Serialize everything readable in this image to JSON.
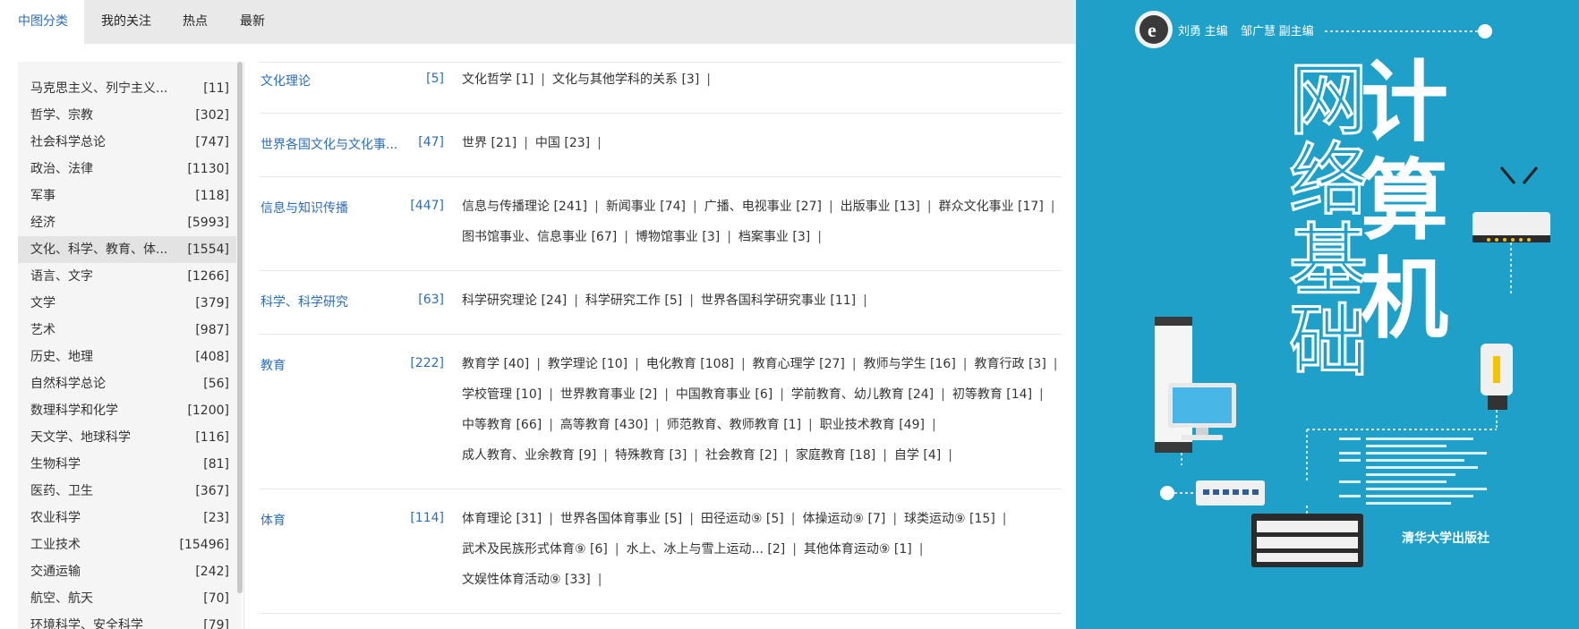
{
  "tabs": [
    {
      "label": "中图分类",
      "active": true
    },
    {
      "label": "我的关注",
      "active": false
    },
    {
      "label": "热点",
      "active": false
    },
    {
      "label": "最新",
      "active": false
    }
  ],
  "left_categories": [
    {
      "name": "马克思主义、列宁主义...",
      "count": "[11]"
    },
    {
      "name": "哲学、宗教",
      "count": "[302]"
    },
    {
      "name": "社会科学总论",
      "count": "[747]"
    },
    {
      "name": "政治、法律",
      "count": "[1130]"
    },
    {
      "name": "军事",
      "count": "[118]"
    },
    {
      "name": "经济",
      "count": "[5993]"
    },
    {
      "name": "文化、科学、教育、体...",
      "count": "[1554]",
      "selected": true
    },
    {
      "name": "语言、文字",
      "count": "[1266]"
    },
    {
      "name": "文学",
      "count": "[379]"
    },
    {
      "name": "艺术",
      "count": "[987]"
    },
    {
      "name": "历史、地理",
      "count": "[408]"
    },
    {
      "name": "自然科学总论",
      "count": "[56]"
    },
    {
      "name": "数理科学和化学",
      "count": "[1200]"
    },
    {
      "name": "天文学、地球科学",
      "count": "[116]"
    },
    {
      "name": "生物科学",
      "count": "[81]"
    },
    {
      "name": "医药、卫生",
      "count": "[367]"
    },
    {
      "name": "农业科学",
      "count": "[23]"
    },
    {
      "name": "工业技术",
      "count": "[15496]"
    },
    {
      "name": "交通运输",
      "count": "[242]"
    },
    {
      "name": "航空、航天",
      "count": "[70]"
    },
    {
      "name": "环境科学、安全科学",
      "count": "[79]"
    }
  ],
  "sections": [
    {
      "title": "文化理论",
      "count": "[5]",
      "lines": [
        [
          "文化哲学 [1]",
          "文化与其他学科的关系 [3]"
        ]
      ]
    },
    {
      "title": "世界各国文化与文化事...",
      "count": "[47]",
      "lines": [
        [
          "世界 [21]",
          "中国 [23]"
        ]
      ]
    },
    {
      "title": "信息与知识传播",
      "count": "[447]",
      "lines": [
        [
          "信息与传播理论 [241]",
          "新闻事业 [74]",
          "广播、电视事业 [27]",
          "出版事业 [13]",
          "群众文化事业 [17]"
        ],
        [
          "图书馆事业、信息事业 [67]",
          "博物馆事业 [3]",
          "档案事业 [3]"
        ]
      ]
    },
    {
      "title": "科学、科学研究",
      "count": "[63]",
      "lines": [
        [
          "科学研究理论 [24]",
          "科学研究工作 [5]",
          "世界各国科学研究事业 [11]"
        ]
      ]
    },
    {
      "title": "教育",
      "count": "[222]",
      "lines": [
        [
          "教育学 [40]",
          "教学理论 [10]",
          "电化教育 [108]",
          "教育心理学 [27]",
          "教师与学生 [16]",
          "教育行政 [3]"
        ],
        [
          "学校管理 [10]",
          "世界教育事业 [2]",
          "中国教育事业 [6]",
          "学前教育、幼儿教育 [24]",
          "初等教育 [14]"
        ],
        [
          "中等教育 [66]",
          "高等教育 [430]",
          "师范教育、教师教育 [1]",
          "职业技术教育 [49]"
        ],
        [
          "成人教育、业余教育 [9]",
          "特殊教育 [3]",
          "社会教育 [2]",
          "家庭教育 [18]",
          "自学 [4]"
        ]
      ]
    },
    {
      "title": "体育",
      "count": "[114]",
      "lines": [
        [
          "体育理论 [31]",
          "世界各国体育事业 [5]",
          "田径运动⑨ [5]",
          "体操运动⑨ [7]",
          "球类运动⑨ [15]"
        ],
        [
          "武术及民族形式体育⑨ [6]",
          "水上、冰上与雪上运动... [2]",
          "其他体育运动⑨ [1]"
        ],
        [
          "文娱性体育活动⑨ [33]"
        ]
      ]
    }
  ],
  "separator": "|",
  "cover": {
    "authors": "刘勇 主编    邹广慧 副主编",
    "title_right": "计算机",
    "title_left": "网络基础",
    "publisher": "清华大学出版社",
    "logo_letter": "e",
    "bg_color": "#1fa0c8"
  }
}
